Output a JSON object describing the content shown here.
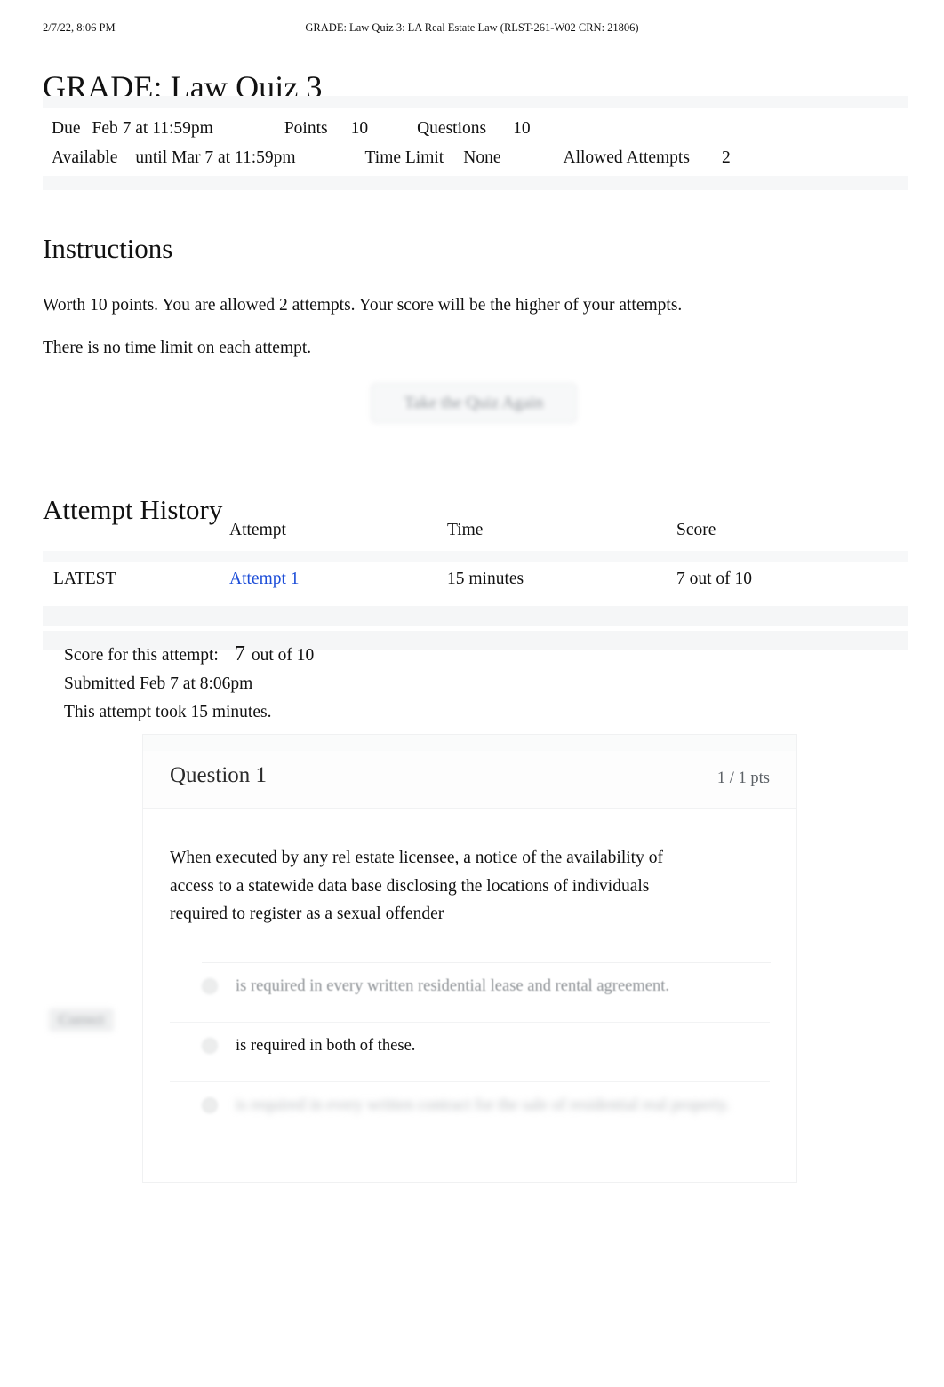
{
  "print_header": {
    "date": "2/7/22, 8:06 PM",
    "title": "GRADE: Law Quiz 3: LA Real Estate Law (RLST-261-W02 CRN: 21806)"
  },
  "page_title": "GRADE: Law Quiz 3",
  "meta": {
    "due_label": "Due",
    "due_value": "Feb 7 at 11:59pm",
    "points_label": "Points",
    "points_value": "10",
    "questions_label": "Questions",
    "questions_value": "10",
    "available_label": "Available",
    "available_value": "until Mar 7 at 11:59pm",
    "time_limit_label": "Time Limit",
    "time_limit_value": "None",
    "allowed_attempts_label": "Allowed Attempts",
    "allowed_attempts_value": "2"
  },
  "instructions": {
    "heading": "Instructions",
    "paragraph_1": "Worth 10 points. You are allowed 2 attempts. Your score will be the higher of your attempts.",
    "paragraph_2": "There is no time limit on each attempt.",
    "retake_button": "Take the Quiz Again"
  },
  "attempt_history": {
    "heading": "Attempt History",
    "columns": {
      "flag": "",
      "attempt": "Attempt",
      "time": "Time",
      "score": "Score"
    },
    "rows": [
      {
        "flag": "LATEST",
        "attempt": "Attempt 1",
        "time": "15 minutes",
        "score": "7 out of 10"
      }
    ]
  },
  "score_summary": {
    "score_label": "Score for this attempt:",
    "score_value": "7",
    "score_suffix": "out of 10",
    "submitted": "Submitted Feb 7 at 8:06pm",
    "duration": "This attempt took 15 minutes."
  },
  "question": {
    "title": "Question 1",
    "points": "1 / 1 pts",
    "text": "When executed by any rel estate licensee, a notice of the availability of access to a statewide data base disclosing the locations of individuals required to register as a sexual offender",
    "correct_tag": "Correct",
    "answers": [
      {
        "text": "is required in every written residential lease and rental agreement."
      },
      {
        "text": "is required in both of these."
      },
      {
        "text": "is required in every written contract for the sale of residential real property."
      }
    ]
  },
  "colors": {
    "link": "#1d4ed8",
    "band": "#f6f7f8",
    "text": "#111111",
    "muted": "#5c6166"
  }
}
